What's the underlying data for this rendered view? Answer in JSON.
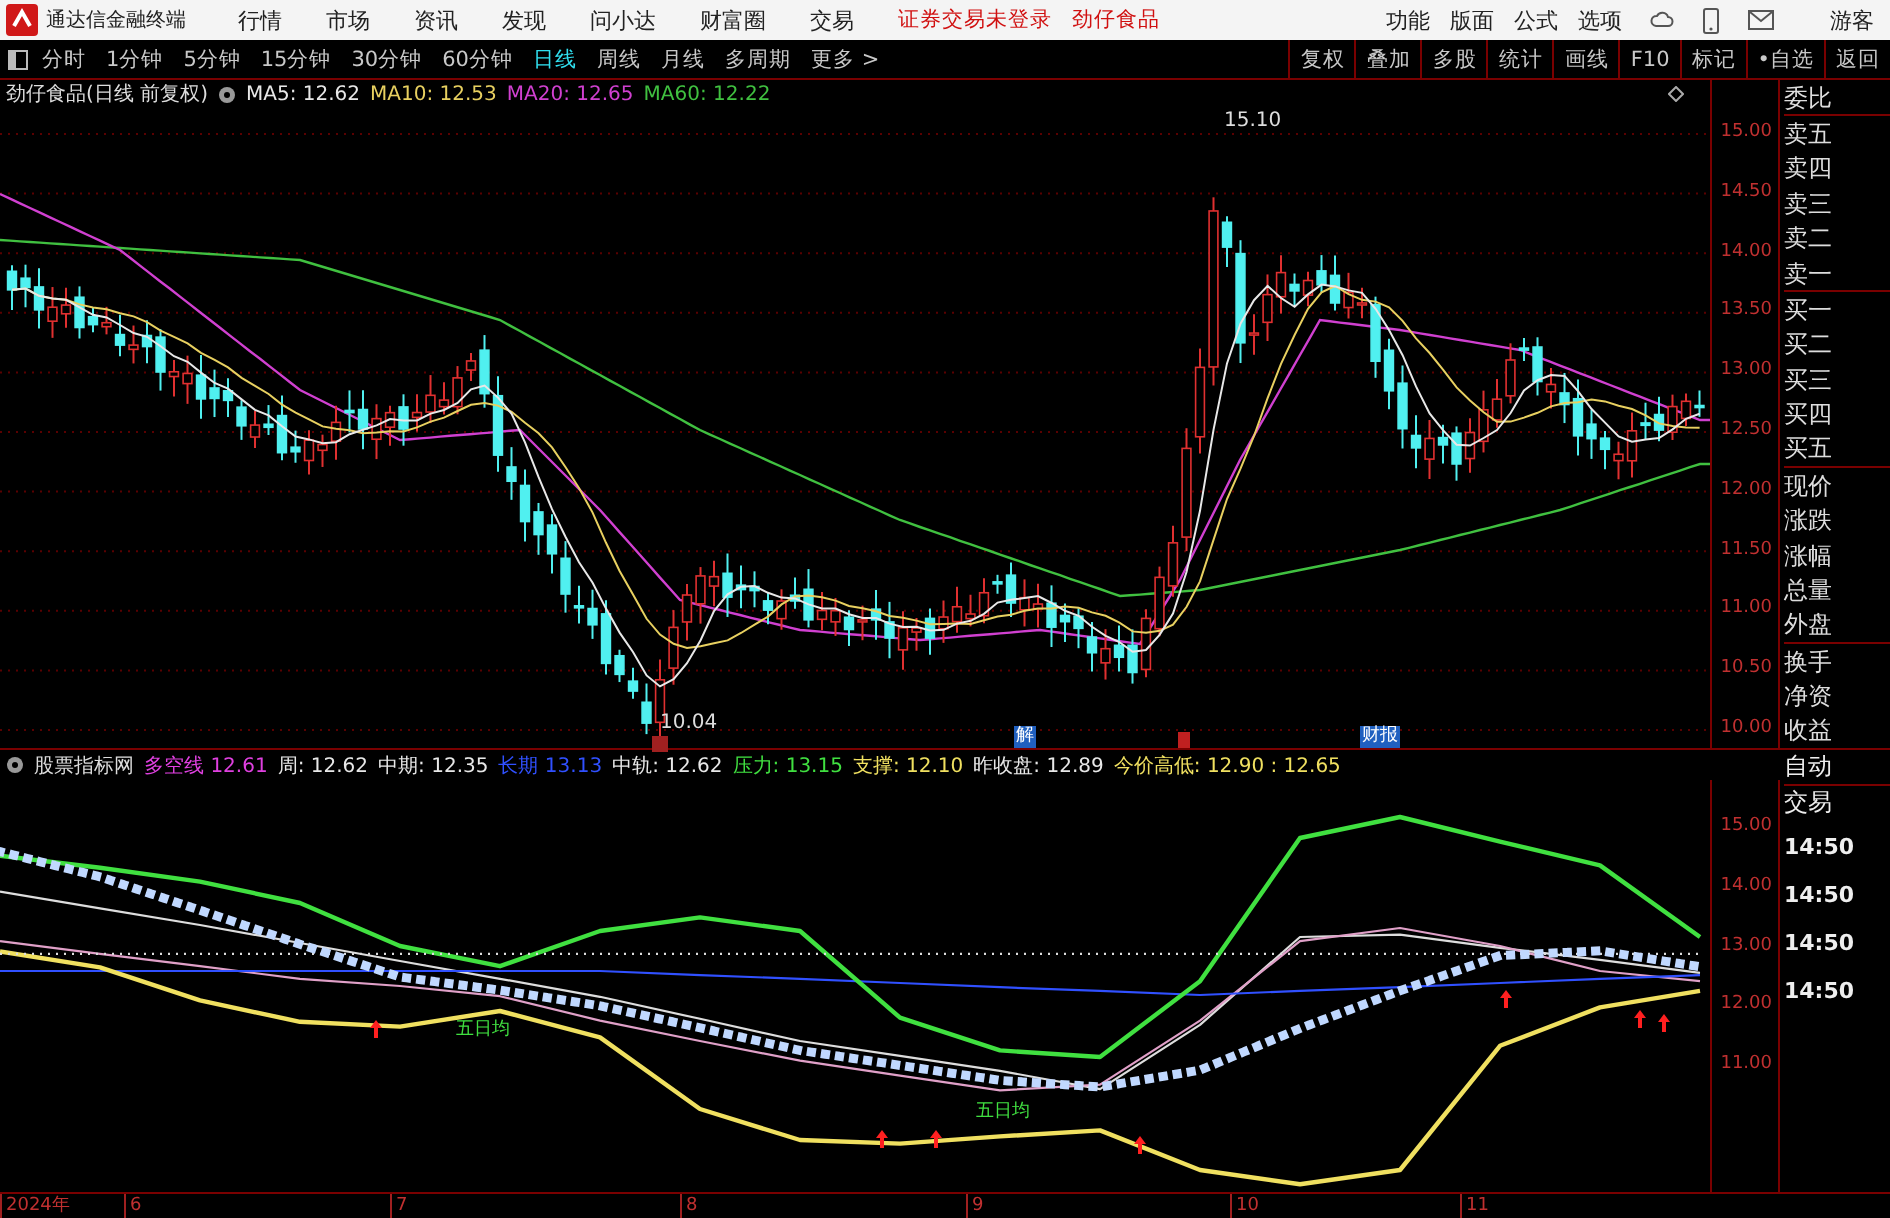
{
  "menu_bar": {
    "app_title": "通达信金融终端",
    "menus": [
      "行情",
      "市场",
      "资讯",
      "发现",
      "问小达",
      "财富圈",
      "交易"
    ],
    "login_status": "证券交易未登录",
    "stock_name": "劲仔食品",
    "actions": [
      "功能",
      "版面",
      "公式",
      "选项"
    ],
    "user": "游客"
  },
  "period_tabs": [
    {
      "label": "分时",
      "selected": false
    },
    {
      "label": "1分钟",
      "selected": false
    },
    {
      "label": "5分钟",
      "selected": false
    },
    {
      "label": "15分钟",
      "selected": false
    },
    {
      "label": "30分钟",
      "selected": false
    },
    {
      "label": "60分钟",
      "selected": false
    },
    {
      "label": "日线",
      "selected": true
    },
    {
      "label": "周线",
      "selected": false
    },
    {
      "label": "月线",
      "selected": false
    },
    {
      "label": "多周期",
      "selected": false
    },
    {
      "label": "更多 >",
      "selected": false
    }
  ],
  "tool_buttons": [
    "复权",
    "叠加",
    "多股",
    "统计",
    "画线",
    "F10",
    "标记",
    "•自选",
    "返回"
  ],
  "main_chart": {
    "title": "劲仔食品(日线 前复权)",
    "indicators": [
      {
        "label": "MA5:",
        "value": "12.62",
        "color": "#e8e8e8"
      },
      {
        "label": "MA10:",
        "value": "12.53",
        "color": "#e8d060"
      },
      {
        "label": "MA20:",
        "value": "12.65",
        "color": "#d040d0"
      },
      {
        "label": "MA60:",
        "value": "12.22",
        "color": "#40c040"
      }
    ],
    "high_label": "15.10",
    "low_label": "10.04",
    "markers": [
      {
        "text": "解",
        "color": "#2060c0"
      },
      {
        "text": "财报",
        "color": "#2060c0"
      }
    ],
    "axis_labels": [
      "15.00",
      "14.50",
      "14.00",
      "13.50",
      "13.00",
      "12.50",
      "12.00",
      "11.50",
      "11.00",
      "10.50",
      "10.00"
    ]
  },
  "quote_panel": {
    "labels": [
      "委比",
      "卖五",
      "卖四",
      "卖三",
      "卖二",
      "卖一",
      "买一",
      "买二",
      "买三",
      "买四",
      "买五",
      "现价",
      "涨跌",
      "涨幅",
      "总量",
      "外盘",
      "换手",
      "净资",
      "收益"
    ]
  },
  "indicator_panel": {
    "name": "股票指标网",
    "values": [
      {
        "kind": "series",
        "value": "12.61",
        "color": "#e040e0"
      },
      {
        "kind": "series",
        "value": "12.62",
        "color": "#e8e8e8"
      },
      {
        "kind": "series",
        "value": "12.35",
        "color": "#e8e8e8"
      },
      {
        "kind": "series",
        "value": "13.13",
        "color": "#3050ff"
      },
      {
        "kind": "plain",
        "label": "中轨:",
        "value": "12.62",
        "color": "#e8e8e8"
      },
      {
        "kind": "series",
        "value": "13.15",
        "color": "#40e040"
      },
      {
        "kind": "series",
        "value": "12.10",
        "color": "#f0e060"
      },
      {
        "kind": "series",
        "value": "12.89",
        "color": "#e8e8e8"
      },
      {
        "kind": "plain",
        "label": "今价高低:",
        "value": "12.90 : 12.65",
        "color": "#f0e060"
      }
    ],
    "signal_labels": [
      "五日均",
      "五日均"
    ],
    "chart_data": {
      "type": "line",
      "ylim": [
        8.9,
        15.8
      ],
      "yticks": [
        {
          "value": 15,
          "label": "15.00"
        },
        {
          "value": 14,
          "label": "14.00"
        },
        {
          "value": 13,
          "label": "13.00"
        },
        {
          "value": 12,
          "label": "12.00"
        },
        {
          "value": 11,
          "label": "11.00"
        }
      ],
      "series": [
        {
          "name": "多空线",
          "color": "#c0d8ff",
          "line_style": "dotted",
          "values": [
            14.6,
            14.18,
            13.62,
            13.05,
            12.5,
            12.28,
            12.02,
            11.65,
            11.27,
            11.02,
            10.77,
            10.66,
            10.94,
            11.64,
            12.27,
            12.86,
            12.94,
            12.67
          ]
        },
        {
          "name": "周:",
          "color": "#dddddd",
          "values": [
            13.93,
            13.65,
            13.37,
            13.07,
            12.77,
            12.47,
            12.17,
            11.8,
            11.43,
            11.18,
            10.93,
            10.62,
            11.7,
            13.17,
            13.21,
            12.99,
            12.79,
            12.57
          ]
        },
        {
          "name": "中期:",
          "color": "#e0a0c8",
          "values": [
            13.1,
            12.89,
            12.68,
            12.47,
            12.35,
            12.18,
            11.77,
            11.43,
            11.1,
            10.85,
            10.6,
            10.7,
            11.77,
            13.1,
            13.32,
            13.02,
            12.6,
            12.43
          ]
        },
        {
          "name": "长期",
          "color": "#3050ff",
          "values": [
            12.6,
            12.6,
            12.6,
            12.6,
            12.6,
            12.6,
            12.6,
            12.53,
            12.47,
            12.4,
            12.33,
            12.27,
            12.2,
            12.27,
            12.33,
            12.4,
            12.47,
            12.53
          ]
        },
        {
          "name": "压力:",
          "color": "#40e040",
          "values": [
            14.53,
            14.33,
            14.1,
            13.74,
            13.02,
            12.68,
            13.27,
            13.5,
            13.27,
            11.82,
            11.27,
            11.16,
            12.43,
            14.83,
            15.18,
            14.77,
            14.37,
            13.17
          ]
        },
        {
          "name": "支撑:",
          "color": "#f0e060",
          "values": [
            12.93,
            12.66,
            12.11,
            11.75,
            11.67,
            11.93,
            11.49,
            10.29,
            9.77,
            9.71,
            9.83,
            9.93,
            9.27,
            9.03,
            9.27,
            11.35,
            11.99,
            12.27
          ]
        },
        {
          "name": "昨收盘:",
          "color": "#dddddd",
          "line_style": "dotted",
          "values": [
            12.89,
            12.89,
            12.89,
            12.89,
            12.89,
            12.89,
            12.89,
            12.89,
            12.89,
            12.89,
            12.89,
            12.89,
            12.89,
            12.89,
            12.89,
            12.89,
            12.89,
            12.89
          ]
        }
      ]
    }
  },
  "trade_panel": {
    "labels": [
      "自动",
      "交易"
    ],
    "times": [
      "14:50",
      "14:50",
      "14:50",
      "14:50"
    ]
  },
  "time_axis": [
    "2024年",
    "6",
    "7",
    "8",
    "9",
    "10",
    "11"
  ]
}
